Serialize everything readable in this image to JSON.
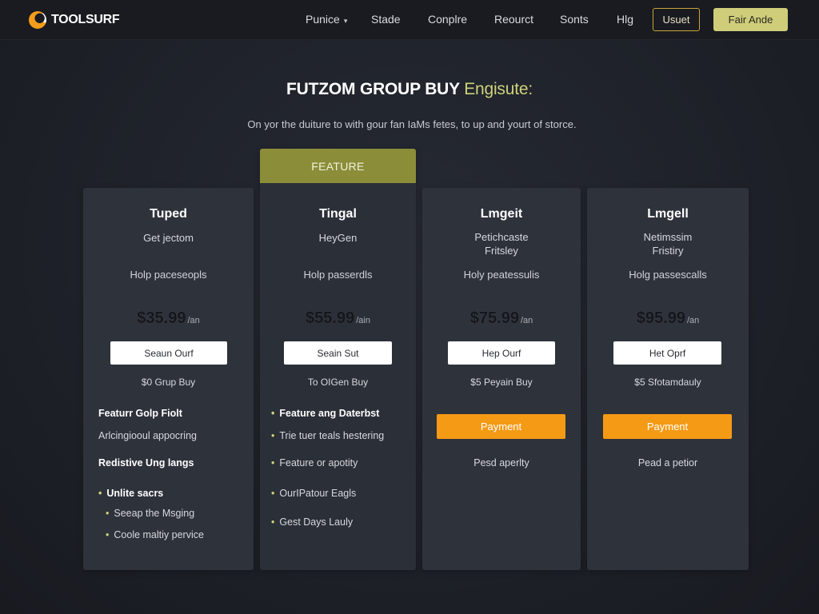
{
  "nav": {
    "logo": "TOOLSURF",
    "links": [
      "Punice",
      "Stade",
      "Conplre",
      "Reourct",
      "Sonts",
      "Hlg"
    ],
    "outline_button": "Usuet",
    "solid_button": "Fair Ande"
  },
  "hero": {
    "title": "FUTZOM GROUP BUY",
    "title_accent": "Engisute:",
    "subtitle": "On yor the duiture to with gour fan IaMs fetes, to up and yourt of storce."
  },
  "featured_label": "FEATURE",
  "plans": [
    {
      "title": "Tuped",
      "subtitle": [
        "Get jectom"
      ],
      "help": "Holp paceseopls",
      "price": "$35.99",
      "per": "/an",
      "cta": "Seaun Ourf",
      "group": "$0 Grup Buy",
      "features": [
        {
          "text": "Featurr Golp Fiolt",
          "bold": true
        },
        {
          "text": "Arlcingiooul appocring",
          "bold": false
        },
        {
          "text": "Redistive Ung langs",
          "bold": true
        },
        {
          "text": "Unlite sacrs",
          "bold": true,
          "dot": true
        },
        {
          "text": "Seeap the Msging",
          "bold": false,
          "dot": true
        },
        {
          "text": "Coole maltiy pervice",
          "bold": false,
          "dot": true
        }
      ]
    },
    {
      "title": "Tingal",
      "subtitle": [
        "HeyGen"
      ],
      "help": "Holp passerdls",
      "price": "$55.99",
      "per": "/ain",
      "cta": "Seain Sut",
      "group": "To OIGen Buy",
      "features": [
        {
          "text": "Feature ang Daterbst",
          "bold": true,
          "dot": true
        },
        {
          "text": "Trie tuer teals hestering",
          "bold": false,
          "dot": true
        },
        {
          "text": "Feature or apotity",
          "bold": false,
          "dot": true
        },
        {
          "text": "OurIPatour Eagls",
          "bold": false,
          "dot": true
        },
        {
          "text": "Gest Days Lauly",
          "bold": false,
          "dot": true
        }
      ]
    },
    {
      "title": "Lmgeit",
      "subtitle": [
        "Petichcaste",
        "Fritsley"
      ],
      "help": "Holy peatessulis",
      "price": "$75.99",
      "per": "/an",
      "cta": "Hep Ourf",
      "group": "$5 Peyain Buy",
      "payment": "Payment",
      "note": "Pesd aperlty"
    },
    {
      "title": "Lmgell",
      "subtitle": [
        "Netimssim",
        "Fristiry"
      ],
      "help": "Holg passescalls",
      "price": "$95.99",
      "per": "/an",
      "cta": "Het Oprf",
      "group": "$5 Sfotamdauly",
      "payment": "Payment",
      "note": "Pead a petior"
    }
  ]
}
